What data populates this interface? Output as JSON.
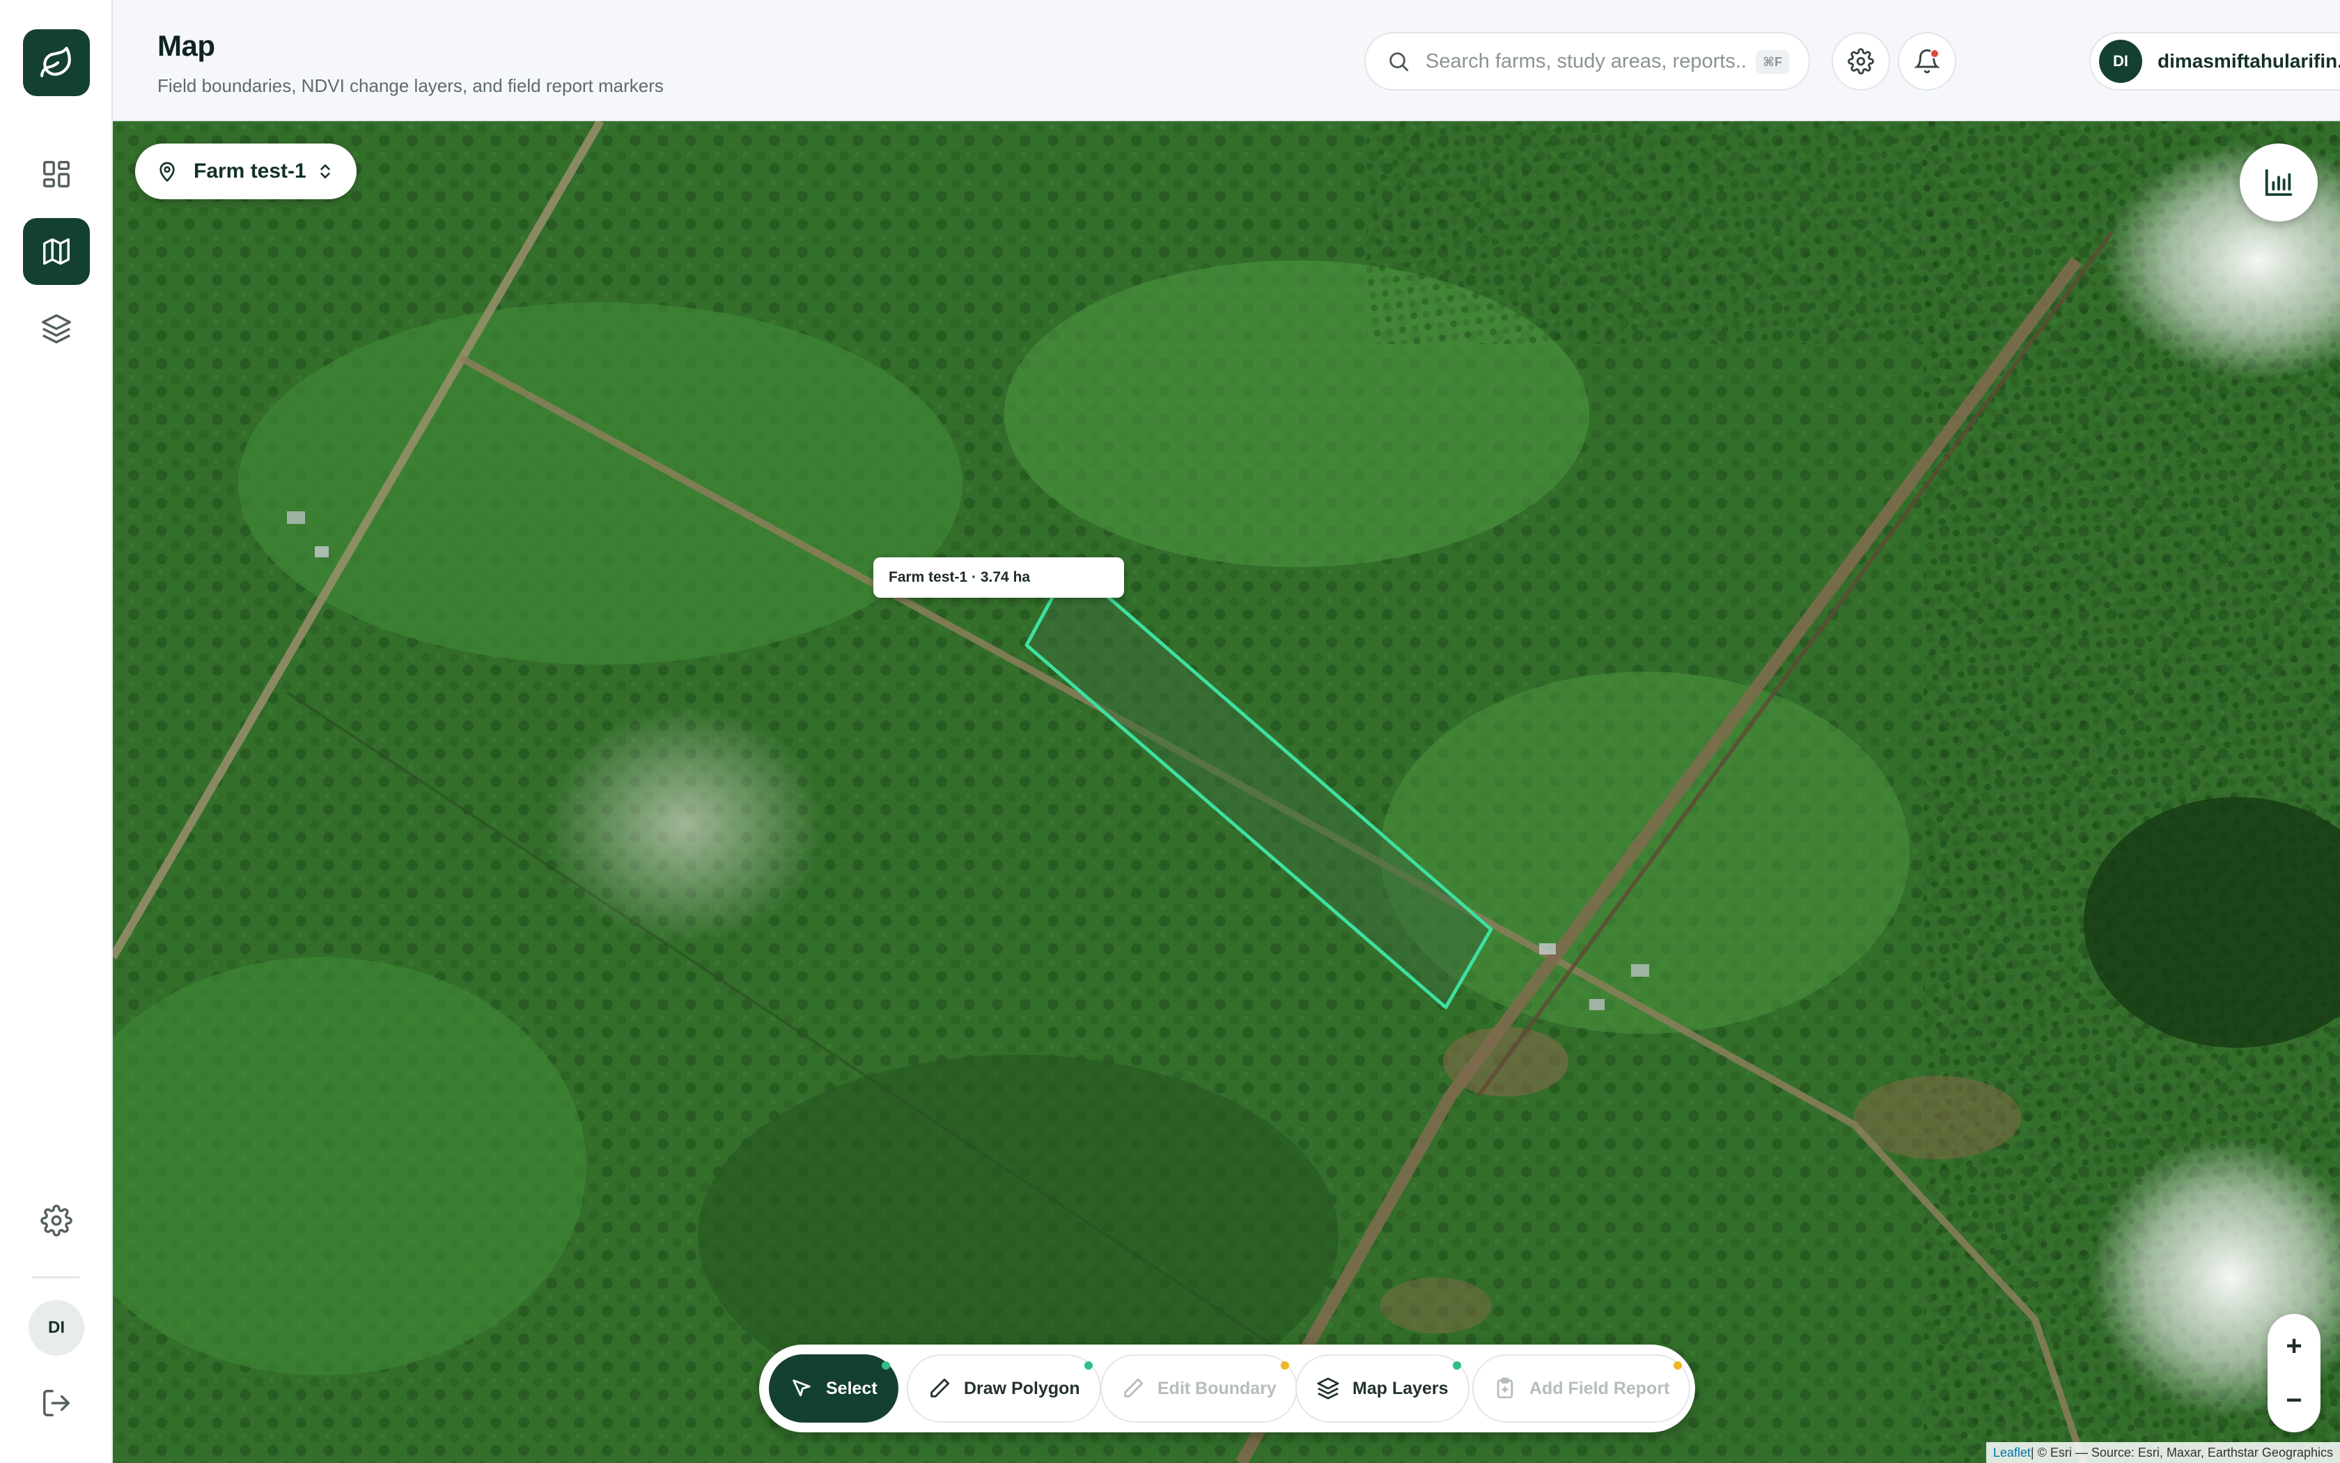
{
  "header": {
    "title": "Map",
    "subtitle": "Field boundaries, NDVI change layers, and field report markers",
    "search_placeholder": "Search farms, study areas, reports...",
    "search_shortcut": "⌘F"
  },
  "user": {
    "initials": "DI",
    "name": "dimasmiftahularifin..."
  },
  "sidebar": {
    "items": [
      {
        "name": "dashboard",
        "icon": "grid-icon",
        "active": false
      },
      {
        "name": "map",
        "icon": "map-icon",
        "active": true
      },
      {
        "name": "layers",
        "icon": "layers-icon",
        "active": false
      }
    ],
    "bottom_avatar": "DI"
  },
  "map": {
    "farm_selector": "Farm test-1",
    "boundary_label": "Farm test-1 · 3.74 ha",
    "boundary_color": "#3ee0a0",
    "attribution_leaflet": "Leaflet",
    "attribution_rest": " | © Esri — Source: Esri, Maxar, Earthstar Geographics",
    "zoom_in": "+",
    "zoom_out": "−"
  },
  "toolbar": {
    "tools": [
      {
        "label": "Select",
        "icon": "cursor-icon",
        "state": "active",
        "dot": "green"
      },
      {
        "label": "Draw Polygon",
        "icon": "pencil-icon",
        "state": "normal",
        "dot": "green"
      },
      {
        "label": "Edit Boundary",
        "icon": "pencil-icon",
        "state": "disabled",
        "dot": "amber"
      },
      {
        "label": "Map Layers",
        "icon": "layers-icon",
        "state": "normal",
        "dot": "green"
      },
      {
        "label": "Add Field Report",
        "icon": "clipboard-icon",
        "state": "disabled",
        "dot": "amber"
      }
    ]
  },
  "colors": {
    "brand": "#14402f",
    "accent": "#2fbf86",
    "warning": "#f0b628",
    "notification": "#d94b3b"
  }
}
